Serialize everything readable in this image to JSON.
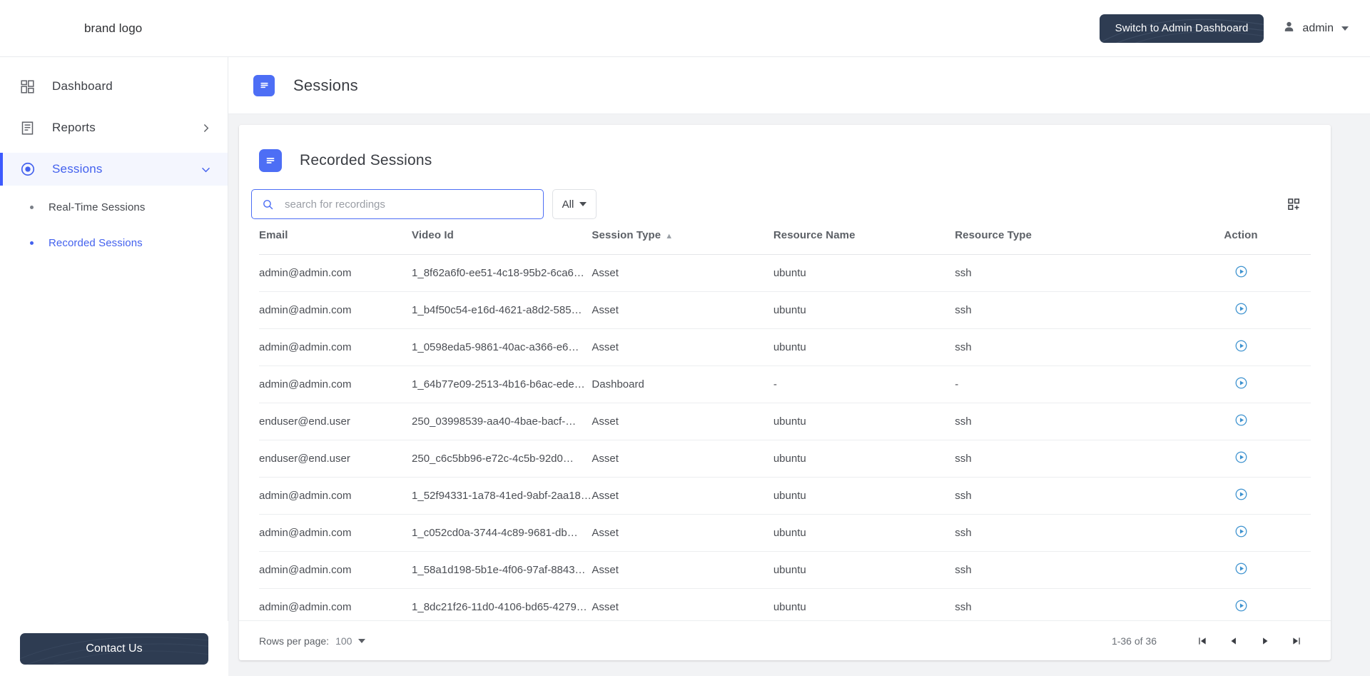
{
  "topbar": {
    "brand_logo": "brand logo",
    "switch_admin_label": "Switch to Admin Dashboard",
    "user_name": "admin"
  },
  "sidebar": {
    "items": [
      {
        "label": "Dashboard",
        "icon": "dashboard-grid-icon",
        "has_chevron": false
      },
      {
        "label": "Reports",
        "icon": "report-document-icon",
        "has_chevron": true
      },
      {
        "label": "Sessions",
        "icon": "sessions-radio-icon",
        "has_chevron": true
      }
    ],
    "sub_items": [
      {
        "label": "Real-Time Sessions",
        "selected": false
      },
      {
        "label": "Recorded Sessions",
        "selected": true
      }
    ],
    "contact_label": "Contact Us"
  },
  "page": {
    "title": "Sessions",
    "card_title": "Recorded Sessions"
  },
  "toolbar": {
    "search_placeholder": "search for recordings",
    "search_value": "",
    "filter_value": "All",
    "grid_add_icon": "grid-add-icon"
  },
  "table": {
    "columns": [
      {
        "label": "Email",
        "sorted": false
      },
      {
        "label": "Video Id",
        "sorted": false
      },
      {
        "label": "Session Type",
        "sorted": true,
        "sort_arrow": "▲"
      },
      {
        "label": "Resource Name",
        "sorted": false
      },
      {
        "label": "Resource Type",
        "sorted": false
      },
      {
        "label": "Action",
        "sorted": false
      }
    ],
    "rows": [
      {
        "email": "admin@admin.com",
        "video_id": "1_8f62a6f0-ee51-4c18-95b2-6ca6…",
        "session_type": "Asset",
        "resource_name": "ubuntu",
        "resource_type": "ssh",
        "action": "play-icon"
      },
      {
        "email": "admin@admin.com",
        "video_id": "1_b4f50c54-e16d-4621-a8d2-585…",
        "session_type": "Asset",
        "resource_name": "ubuntu",
        "resource_type": "ssh",
        "action": "play-icon"
      },
      {
        "email": "admin@admin.com",
        "video_id": "1_0598eda5-9861-40ac-a366-e6…",
        "session_type": "Asset",
        "resource_name": "ubuntu",
        "resource_type": "ssh",
        "action": "play-icon"
      },
      {
        "email": "admin@admin.com",
        "video_id": "1_64b77e09-2513-4b16-b6ac-ede…",
        "session_type": "Dashboard",
        "resource_name": "-",
        "resource_type": "-",
        "action": "play-icon"
      },
      {
        "email": "enduser@end.user",
        "video_id": "250_03998539-aa40-4bae-bacf-…",
        "session_type": "Asset",
        "resource_name": "ubuntu",
        "resource_type": "ssh",
        "action": "play-icon"
      },
      {
        "email": "enduser@end.user",
        "video_id": "250_c6c5bb96-e72c-4c5b-92d0…",
        "session_type": "Asset",
        "resource_name": "ubuntu",
        "resource_type": "ssh",
        "action": "play-icon"
      },
      {
        "email": "admin@admin.com",
        "video_id": "1_52f94331-1a78-41ed-9abf-2aa18…",
        "session_type": "Asset",
        "resource_name": "ubuntu",
        "resource_type": "ssh",
        "action": "play-icon"
      },
      {
        "email": "admin@admin.com",
        "video_id": "1_c052cd0a-3744-4c89-9681-db…",
        "session_type": "Asset",
        "resource_name": "ubuntu",
        "resource_type": "ssh",
        "action": "play-icon"
      },
      {
        "email": "admin@admin.com",
        "video_id": "1_58a1d198-5b1e-4f06-97af-8843…",
        "session_type": "Asset",
        "resource_name": "ubuntu",
        "resource_type": "ssh",
        "action": "play-icon"
      },
      {
        "email": "admin@admin.com",
        "video_id": "1_8dc21f26-11d0-4106-bd65-4279…",
        "session_type": "Asset",
        "resource_name": "ubuntu",
        "resource_type": "ssh",
        "action": "play-icon"
      }
    ]
  },
  "footer": {
    "rows_per_page_label": "Rows per page:",
    "rows_per_page_value": "100",
    "range_label": "1-36 of 36",
    "first_page_icon": "first-page-icon",
    "prev_page_icon": "previous-page-icon",
    "next_page_icon": "next-page-icon",
    "last_page_icon": "last-page-icon"
  },
  "colors": {
    "accent_blue": "#4d6ef5",
    "dark_navy": "#2e3c52",
    "play_blue": "#3d92cf",
    "content_bg": "#f2f3f5"
  }
}
